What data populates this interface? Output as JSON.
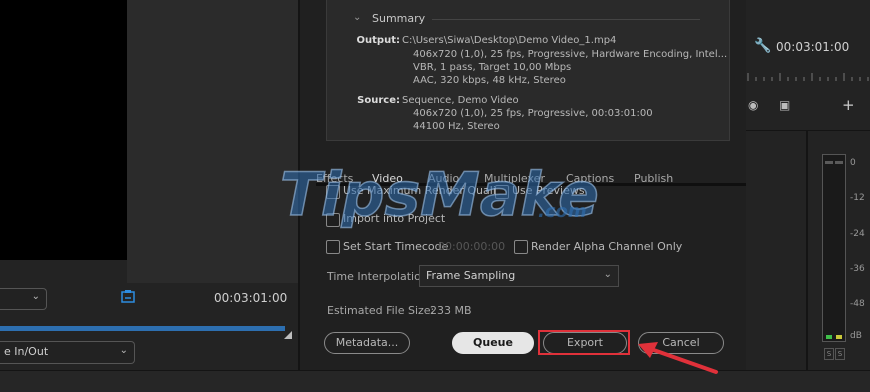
{
  "left_panel": {
    "fit_dropdown_value": "",
    "source_timecode": "00:03:01:00",
    "range_dropdown_label": "e In/Out"
  },
  "summary": {
    "title": "Summary",
    "output_label": "Output:",
    "output_lines": [
      "C:\\Users\\Siwa\\Desktop\\Demo Video_1.mp4",
      "406x720 (1,0), 25 fps, Progressive, Hardware Encoding, Intel...",
      "VBR, 1 pass, Target 10,00 Mbps",
      "AAC, 320 kbps, 48 kHz, Stereo"
    ],
    "source_label": "Source:",
    "source_lines": [
      "Sequence, Demo Video",
      "406x720 (1,0), 25 fps, Progressive, 00:03:01:00",
      "44100 Hz, Stereo"
    ]
  },
  "tabs": [
    "Effects",
    "Video",
    "Audio",
    "Multiplexer",
    "Captions",
    "Publish"
  ],
  "options": {
    "max_render_quality": "Use Maximum Render Quality",
    "use_previews": "Use Previews",
    "import_into_project": "Import into Project",
    "set_start_timecode": "Set Start Timecode",
    "start_timecode_value": "00:00:00:00",
    "render_alpha": "Render Alpha Channel Only"
  },
  "time_interpolation": {
    "label": "Time Interpolation:",
    "value": "Frame Sampling"
  },
  "file_size": {
    "label": "Estimated File Size:",
    "value": "233 MB"
  },
  "buttons": {
    "metadata": "Metadata...",
    "queue": "Queue",
    "export": "Export",
    "cancel": "Cancel"
  },
  "right_panel": {
    "timecode": "00:03:01:00",
    "meter_labels": [
      "0",
      "-12",
      "-24",
      "-36",
      "-48",
      "dB"
    ],
    "solo_labels": [
      "S",
      "S"
    ]
  },
  "watermark": "TipsMake.com",
  "colors": {
    "progress_accent": "#2d6fb0",
    "highlight": "#e0313a",
    "meter_green": "#3fbf4a",
    "meter_yellow": "#c9c83a"
  }
}
